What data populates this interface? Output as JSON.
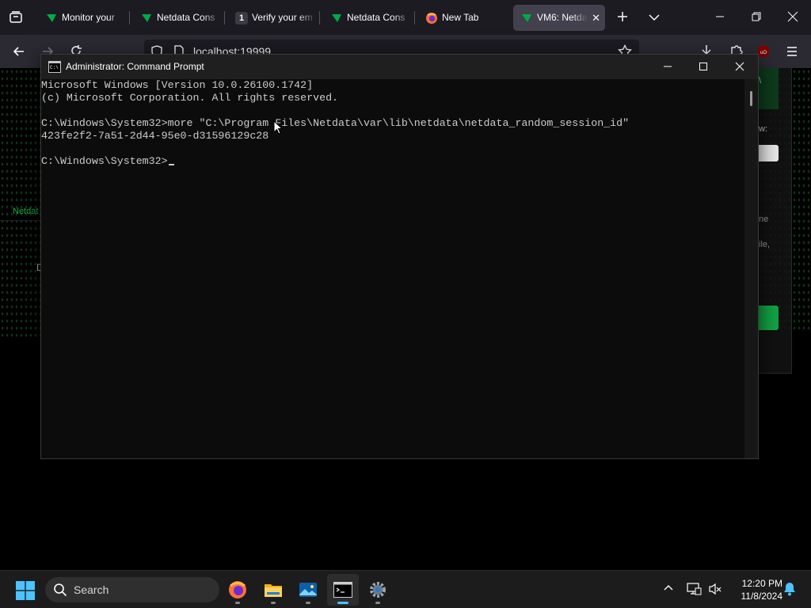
{
  "browser": {
    "tabs": [
      {
        "title": "Monitor your",
        "favicon": "netdata-icon"
      },
      {
        "title": "Netdata Cons",
        "favicon": "netdata-icon"
      },
      {
        "title": "Verify your em",
        "favicon": "badge-1",
        "badge": "1"
      },
      {
        "title": "Netdata Cons",
        "favicon": "netdata-icon"
      },
      {
        "title": "New Tab",
        "favicon": "firefox-icon"
      },
      {
        "title": "VM6: Netda",
        "favicon": "netdata-icon",
        "active": true
      }
    ],
    "url": "localhost:19999",
    "colors": {
      "tabstrip": "#1c1b22",
      "toolbar": "#2b2a33",
      "active_tab": "#42414d"
    }
  },
  "page": {
    "side_link": "Netdat",
    "side_letter": "D",
    "right_texts": [
      "\\",
      "w:",
      "ne",
      "ile,"
    ]
  },
  "cmd": {
    "title": "Administrator: Command Prompt",
    "lines": [
      "Microsoft Windows [Version 10.0.26100.1742]",
      "(c) Microsoft Corporation. All rights reserved.",
      "",
      "C:\\Windows\\System32>more \"C:\\Program Files\\Netdata\\var\\lib\\netdata\\netdata_random_session_id\"",
      "423fe2f2-7a51-2d44-95e0-d31596129c28",
      "",
      "C:\\Windows\\System32>"
    ],
    "colors": {
      "background": "#0c0c0c",
      "text": "#cccccc",
      "titlebar": "#1f1f1f"
    }
  },
  "taskbar": {
    "search_placeholder": "Search",
    "apps": [
      "firefox-icon",
      "file-explorer-icon",
      "photos-icon",
      "terminal-icon",
      "settings-icon"
    ],
    "active_app": "terminal-icon",
    "time": "12:20 PM",
    "date": "11/8/2024",
    "accent": "#4cc2ff"
  }
}
